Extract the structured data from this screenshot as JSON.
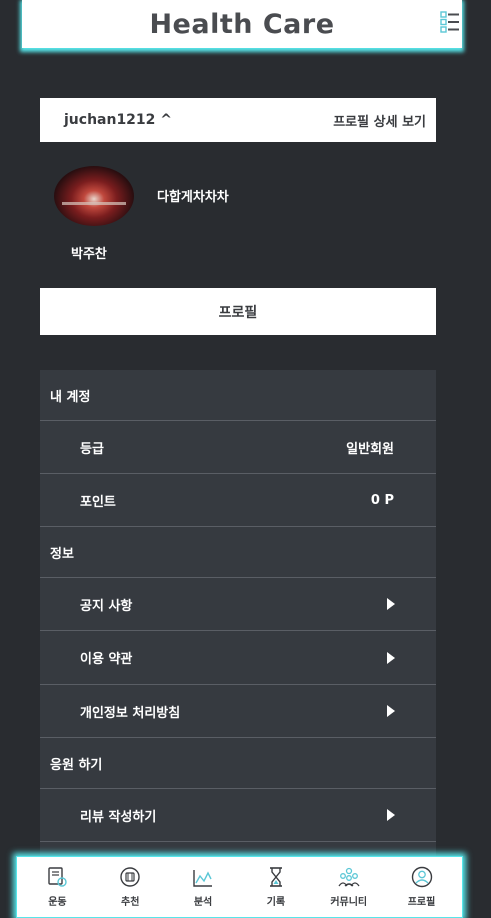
{
  "header": {
    "title": "Health Care",
    "menu_icon": "hamburger-menu-icon"
  },
  "profile_bar": {
    "username": "juchan1212 ^",
    "detail_link": "프로필 상세 보기"
  },
  "profile": {
    "nickname": "다합게차차차",
    "name": "박주찬"
  },
  "profile_button": "프로필",
  "menu": {
    "sections": [
      {
        "title": "내 계정",
        "items": [
          {
            "label": "등급",
            "value": "일반회원"
          },
          {
            "label": "포인트",
            "value": "0 P"
          }
        ]
      },
      {
        "title": "정보",
        "items": [
          {
            "label": "공지 사항",
            "icon": "play-arrow-icon"
          },
          {
            "label": "이용 약관",
            "icon": "play-arrow-icon"
          },
          {
            "label": "개인정보 처리방침",
            "icon": "play-arrow-icon"
          }
        ]
      },
      {
        "title": "응원 하기",
        "items": [
          {
            "label": "리뷰 작성하기",
            "icon": "play-arrow-icon"
          }
        ]
      }
    ]
  },
  "bottom_nav": [
    {
      "label": "운동",
      "icon": "exercise-icon"
    },
    {
      "label": "추천",
      "icon": "recommend-icon"
    },
    {
      "label": "분석",
      "icon": "chart-icon"
    },
    {
      "label": "기록",
      "icon": "hourglass-icon"
    },
    {
      "label": "커뮤니티",
      "icon": "community-icon"
    },
    {
      "label": "프로필",
      "icon": "profile-icon"
    }
  ],
  "colors": {
    "background": "#292c30",
    "panel": "#363a40",
    "accent_glow": "#57e6ea",
    "icon_accent": "#5bc7d6"
  }
}
